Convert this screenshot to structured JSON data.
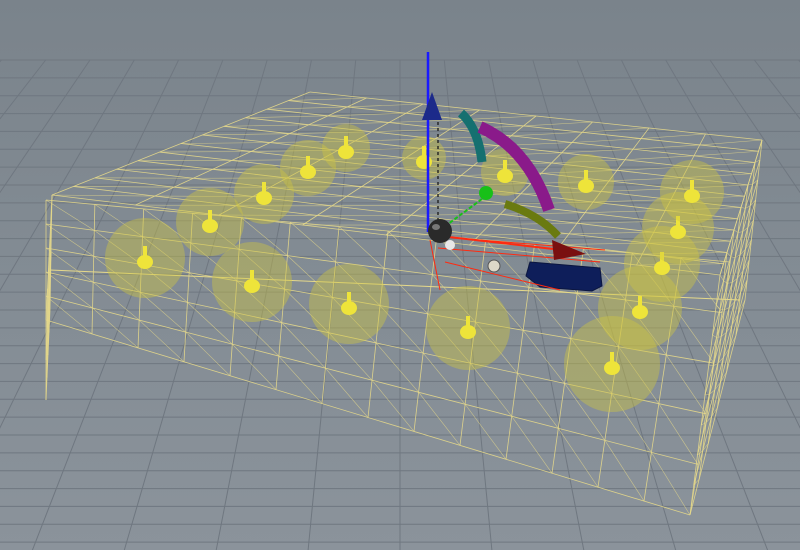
{
  "viewport": {
    "background_color": "#808890",
    "grid_color": "#6f7780",
    "wire_color": "#e6d98a",
    "light_fill_color": "#cfc640",
    "light_bulb_color": "#eee43a"
  },
  "gizmo": {
    "z_axis_color": "#1a1aff",
    "z_arrow_color": "#1c2a8a",
    "x_axis_color": "#ff2a10",
    "x_arrow_color": "#7a1010",
    "y_axis_color": "#18c018",
    "rotate_ring_colors": [
      "#157070",
      "#8a1a8a",
      "#6a7a10"
    ],
    "center_color": "#2a2a2a"
  },
  "scene_objects": {
    "selected_object_color": "#0e1e5a",
    "light_count": 16,
    "icons": [
      "light-bulb-icon",
      "rotate-handle-icon",
      "translate-arrow-icon"
    ]
  }
}
